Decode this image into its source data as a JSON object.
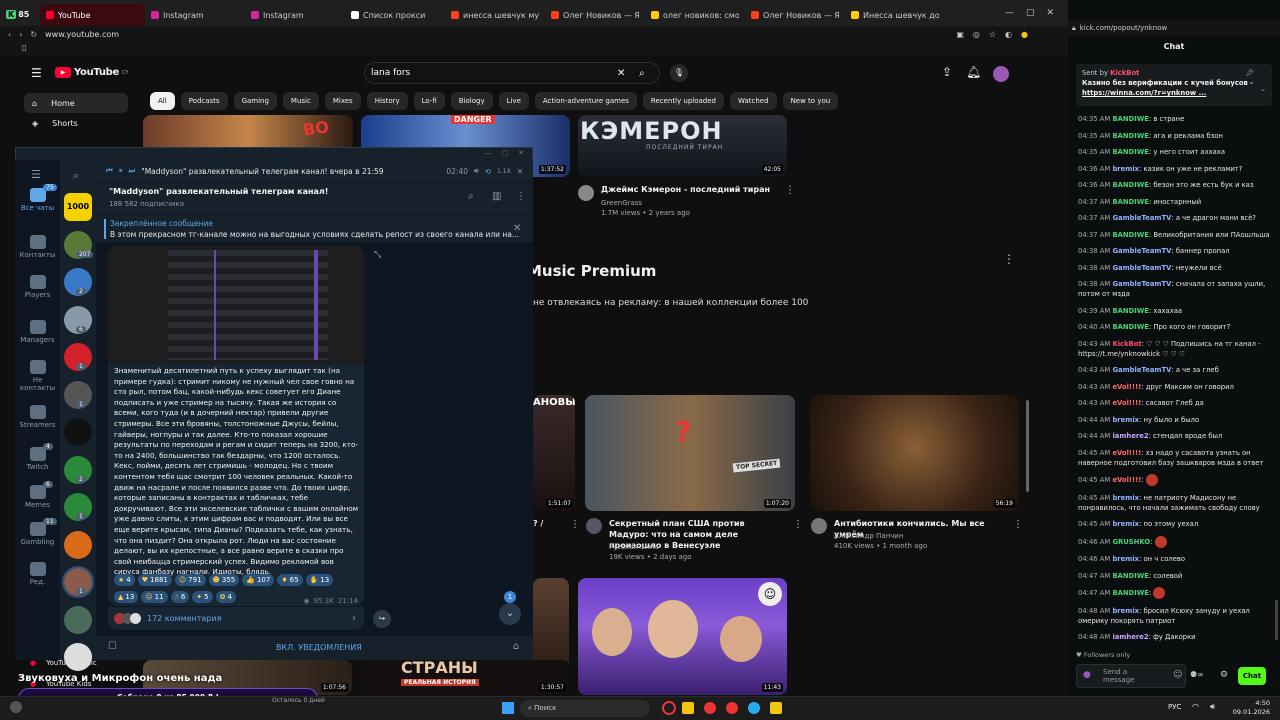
{
  "browser": {
    "tabs": [
      {
        "label": "YouTube",
        "color": "#ff0033",
        "active": true
      },
      {
        "label": "Instagram",
        "color": "#d6249f"
      },
      {
        "label": "Instagram",
        "color": "#d6249f"
      },
      {
        "label": "Список прокси",
        "color": "#ffffff"
      },
      {
        "label": "инесса шевчук муж – Я",
        "color": "#fc3f1d"
      },
      {
        "label": "Олег Новиков — Яндекс",
        "color": "#fc3f1d"
      },
      {
        "label": "олег новиков: смотрите",
        "color": "#ffcc00"
      },
      {
        "label": "Олег Новиков — Яндекс",
        "color": "#fc3f1d"
      },
      {
        "label": "Инесса шевчук до и посл",
        "color": "#ffcc00"
      }
    ],
    "counter": "85",
    "url": "www.youtube.com"
  },
  "youtube": {
    "logo": "YouTube",
    "country": "CY",
    "search_value": "lana fors",
    "chips": [
      "All",
      "Podcasts",
      "Gaming",
      "Music",
      "Mixes",
      "History",
      "Lo-fi",
      "Biology",
      "Live",
      "Action-adventure games",
      "Recently uploaded",
      "Watched",
      "New to you"
    ],
    "nav": [
      {
        "label": "Home"
      },
      {
        "label": "Shorts"
      }
    ],
    "top_videos": [
      {
        "duration": "1:37:52"
      },
      {
        "duration": "42:05",
        "title": "Джеймс Кэмерон - последний тиран",
        "channel": "GreenGrass",
        "meta": "1.7M views • 2 years ago",
        "thumb_text": "КЭМЕРОН",
        "thumb_sub": "ПОСЛЕДНИЙ ТИРАН",
        "danger": "DANGER"
      }
    ],
    "premium_title": "Music Premium",
    "premium_text": "не отвлекаясь на рекламу: в нашей коллекции более 100",
    "mid_videos": [
      {
        "duration": "1:51:07",
        "title": "? /",
        "thumb_text": "АНОВЫ"
      },
      {
        "duration": "1:07:20",
        "title": "Секретный план США против Мадуро: что на самом деле произошло в Венесуэле",
        "channel": "Русская Зима",
        "meta": "19K views • 2 days ago",
        "thumb_text": "TOP SECRET"
      },
      {
        "duration": "56:19",
        "title": "Антибиотики кончились. Мы все умрём",
        "channel": "Александр Панчин",
        "meta": "410K views • 1 month ago"
      }
    ],
    "bottom_videos": [
      {
        "duration": "1:07:56"
      },
      {
        "duration": "1:30:57",
        "thumb_text": "СТРАНЫ",
        "thumb_sub": "РЕАЛЬНАЯ ИСТОРИЯ"
      },
      {
        "duration": "11:43"
      }
    ],
    "sidebar_bottom": [
      "YouTube Music",
      "YouTube Kids"
    ]
  },
  "telegram": {
    "header_title": "\"Maddyson\" развлекательный телеграм канал! вчера в 21:59",
    "header_time": "02:40",
    "speed": "1.1X",
    "channel_name": "\"Maddyson\" развлекательный телеграм канал!",
    "subscribers": "188 582 подписчика",
    "pinned_label": "Закреплённое сообщение",
    "pinned_text": "В этом прекрасном тг-канале можно на выгодных условиях сделать репост из своего канала или на...",
    "folders": [
      {
        "label": "Все чаты",
        "badge": "75"
      },
      {
        "label": "Контакты"
      },
      {
        "label": "Players"
      },
      {
        "label": "Managers"
      },
      {
        "label": "Не контакты"
      },
      {
        "label": "Streamers"
      },
      {
        "label": "Twitch",
        "badge": "4"
      },
      {
        "label": "Memes",
        "badge": "6"
      },
      {
        "label": "Gambling",
        "badge": "11"
      },
      {
        "label": "Ред."
      }
    ],
    "chat_list": [
      {
        "label": "1000",
        "color": "#f5d100",
        "badge": ""
      },
      {
        "color": "#5a7a3a",
        "badge": "207"
      },
      {
        "color": "#3a78c8",
        "badge": "2"
      },
      {
        "color": "#8899aa",
        "badge": "6"
      },
      {
        "color": "#d4202a",
        "badge": "1"
      },
      {
        "color": "#555555",
        "badge": "1"
      },
      {
        "color": "#111111",
        "badge": ""
      },
      {
        "color": "#2a8a3a",
        "badge": "2"
      },
      {
        "color": "#2a8a3a",
        "badge": "1"
      },
      {
        "color": "#d96a1a",
        "badge": ""
      },
      {
        "color": "#8a5a4a",
        "badge": "1"
      },
      {
        "color": "#4a6a5a",
        "badge": ""
      },
      {
        "color": "#dddddd",
        "badge": ""
      }
    ],
    "message": "Знаменитый десятилетний путь к успеху выглядит так (на примере гудка): стримит никому не нужный чел свое говно на сто рыл, потом бац, какой-нибудь кекс советует его Диане подписать и уже стример на тысячу. Такая же история со всеми, кого туда (и в дочерний нектар) привели другие стримеры. Все эти бровяны, толстоножные Джусы, бейлы, гайверы, ногпуры и так далее. Кто-то показал хорошие результаты по переходам и регам и сидит теперь на 3200, кто-то на 2400, большинство так бездарны, что 1200 осталось. Кекс, пойми, десять лет стримишь - молодец. Но с твоим контентом тебя щас смотрит 100 человек реальных. Какой-то движ на насрале и после появился разве что. До твоих цифр, которые записаны в контрактах и табличках, тебе докручивают. Все эти экселевские таблички с вашим онлайном уже давно слиты, к этим цифрам вас и подводят. Или вы все еще верите крысам, типа Дианы? Подказать тебе, как узнать, что она пиздит? Она открыла рот. Люди на вас состояние делают, вы их крепостные, а все равно верите в сказки про свой неибацца стримерский успех. Видимо рекламой вов сируса фанбазу нагнали. Идиоты, блядь.",
    "reactions": [
      {
        "emoji": "★",
        "count": "4"
      },
      {
        "emoji": "♥",
        "count": "1881"
      },
      {
        "emoji": "☺",
        "count": "791"
      },
      {
        "emoji": "☻",
        "count": "355"
      },
      {
        "emoji": "👍",
        "count": "107"
      },
      {
        "emoji": "♦",
        "count": "65"
      },
      {
        "emoji": "✋",
        "count": "13"
      },
      {
        "emoji": "▲",
        "count": "13"
      },
      {
        "emoji": "☹",
        "count": "11"
      },
      {
        "emoji": "☝",
        "count": "6"
      },
      {
        "emoji": "✦",
        "count": "5"
      },
      {
        "emoji": "✿",
        "count": "4"
      }
    ],
    "views": "95.3K",
    "msg_time": "21:14",
    "comments": "172 комментария",
    "unread_badge": "1",
    "notify": "ВКЛ. УВЕДОМЛЕНИЯ"
  },
  "kick": {
    "url": "kick.com/popout/ynknow",
    "header": "Chat",
    "pinned_sender": "Sent by",
    "pinned_user": "KickBot",
    "pinned_text": "Казино без верификации с кучей бонусов - ",
    "pinned_link": "https://winna.com/?r=ynknow ...",
    "messages": [
      {
        "t": "04:35 AM",
        "u": "BANDIWE",
        "c": "#49d27a",
        "m": "в стране"
      },
      {
        "t": "04:35 AM",
        "u": "BANDIWE",
        "c": "#49d27a",
        "m": "ага и реклама бзон"
      },
      {
        "t": "04:35 AM",
        "u": "BANDIWE",
        "c": "#49d27a",
        "m": "у него стоит аххаха"
      },
      {
        "t": "04:36 AM",
        "u": "bremix",
        "c": "#8fb2ff",
        "m": "казик он уже не рекламит?"
      },
      {
        "t": "04:36 AM",
        "u": "BANDIWE",
        "c": "#49d27a",
        "m": "безон это же есть бук и каз"
      },
      {
        "t": "04:37 AM",
        "u": "BANDIWE",
        "c": "#49d27a",
        "m": "иностарнный"
      },
      {
        "t": "04:37 AM",
        "u": "GambleTeamTV",
        "c": "#8fb2ff",
        "m": "а че драгон мани всё?"
      },
      {
        "t": "04:37 AM",
        "u": "BANDIWE",
        "c": "#49d27a",
        "m": "Великобритания или ПАошльша"
      },
      {
        "t": "04:38 AM",
        "u": "GambleTeamTV",
        "c": "#8fb2ff",
        "m": "баннер пропал"
      },
      {
        "t": "04:38 AM",
        "u": "GambleTeamTV",
        "c": "#8fb2ff",
        "m": "неужели всё"
      },
      {
        "t": "04:38 AM",
        "u": "GambleTeamTV",
        "c": "#8fb2ff",
        "m": "сначала от запаха ушли, потом от мзда"
      },
      {
        "t": "04:39 AM",
        "u": "BANDIWE",
        "c": "#49d27a",
        "m": "хахахаа"
      },
      {
        "t": "04:40 AM",
        "u": "BANDIWE",
        "c": "#49d27a",
        "m": "Про кого он говорит?"
      },
      {
        "t": "04:43 AM",
        "u": "KickBot",
        "c": "#ff4d6a",
        "m": "♡ ♡ ♡ Подпишись на тг канал - https://t.me/ynknowkick ♡ ♡ ♡"
      },
      {
        "t": "04:43 AM",
        "u": "GambleTeamTV",
        "c": "#8fb2ff",
        "m": "а че за глеб"
      },
      {
        "t": "04:43 AM",
        "u": "eVol!!!!",
        "c": "#ff6b6b",
        "m": "друг Максим он говорил"
      },
      {
        "t": "04:43 AM",
        "u": "eVol!!!!",
        "c": "#ff6b6b",
        "m": "сасавот Глеб да"
      },
      {
        "t": "04:44 AM",
        "u": "bremix",
        "c": "#8fb2ff",
        "m": "ну было и было"
      },
      {
        "t": "04:44 AM",
        "u": "iamhere2",
        "c": "#c7a6ff",
        "m": "стендап вроде был"
      },
      {
        "t": "04:45 AM",
        "u": "eVol!!!!",
        "c": "#ff6b6b",
        "m": "хз надо у сасавота узнать он наверное подготовил базу зашкваров мзда в ответ"
      },
      {
        "t": "04:45 AM",
        "u": "eVol!!!!",
        "c": "#ff6b6b",
        "m": ""
      },
      {
        "t": "04:45 AM",
        "u": "bremix",
        "c": "#8fb2ff",
        "m": "не патриоту Мадисону не понравилось, что начали зажимать свободу слову"
      },
      {
        "t": "04:45 AM",
        "u": "bremix",
        "c": "#8fb2ff",
        "m": "по этому уехал"
      },
      {
        "t": "04:46 AM",
        "u": "GRUSHKO",
        "c": "#49d27a",
        "m": ""
      },
      {
        "t": "04:46 AM",
        "u": "bremix",
        "c": "#8fb2ff",
        "m": "он ч солево"
      },
      {
        "t": "04:47 AM",
        "u": "BANDIWE",
        "c": "#49d27a",
        "m": "солевой"
      },
      {
        "t": "04:47 AM",
        "u": "BANDIWE",
        "c": "#49d27a",
        "m": ""
      },
      {
        "t": "04:48 AM",
        "u": "bremix",
        "c": "#8fb2ff",
        "m": "бросил Ксюху зануду и уехал омерику покорять патриот"
      },
      {
        "t": "04:48 AM",
        "u": "iamhere2",
        "c": "#c7a6ff",
        "m": "фу Дакорки"
      }
    ],
    "followers_only": "Followers only",
    "send_placeholder": "Send a message",
    "chat_button": "Chat"
  },
  "overlay": {
    "donation_text": "Звуковуха и Микрофон очень нада",
    "donation_bar": "Собрано 0  из 85 000 ₽ !",
    "donation_progress": 0,
    "donation_under": "Осталось 0 дней"
  },
  "taskbar": {
    "search": "Поиск",
    "lang": "РУС",
    "time": "4:50",
    "date": "09.01.2026"
  }
}
